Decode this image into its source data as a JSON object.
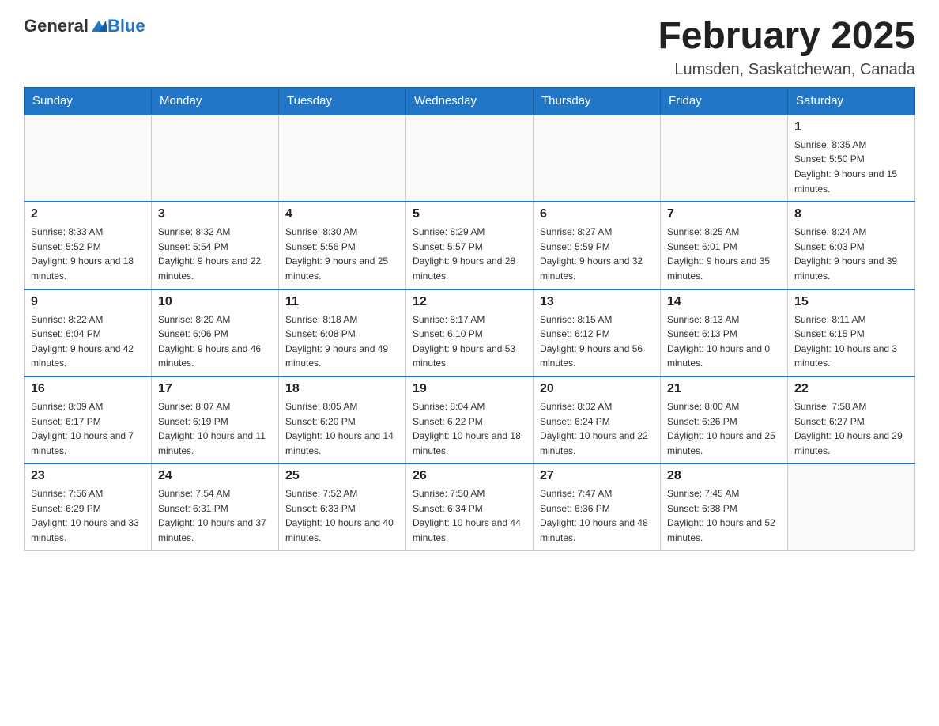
{
  "header": {
    "logo_general": "General",
    "logo_blue": "Blue",
    "month_title": "February 2025",
    "location": "Lumsden, Saskatchewan, Canada"
  },
  "weekdays": [
    "Sunday",
    "Monday",
    "Tuesday",
    "Wednesday",
    "Thursday",
    "Friday",
    "Saturday"
  ],
  "weeks": [
    [
      {
        "day": "",
        "sunrise": "",
        "sunset": "",
        "daylight": ""
      },
      {
        "day": "",
        "sunrise": "",
        "sunset": "",
        "daylight": ""
      },
      {
        "day": "",
        "sunrise": "",
        "sunset": "",
        "daylight": ""
      },
      {
        "day": "",
        "sunrise": "",
        "sunset": "",
        "daylight": ""
      },
      {
        "day": "",
        "sunrise": "",
        "sunset": "",
        "daylight": ""
      },
      {
        "day": "",
        "sunrise": "",
        "sunset": "",
        "daylight": ""
      },
      {
        "day": "1",
        "sunrise": "Sunrise: 8:35 AM",
        "sunset": "Sunset: 5:50 PM",
        "daylight": "Daylight: 9 hours and 15 minutes."
      }
    ],
    [
      {
        "day": "2",
        "sunrise": "Sunrise: 8:33 AM",
        "sunset": "Sunset: 5:52 PM",
        "daylight": "Daylight: 9 hours and 18 minutes."
      },
      {
        "day": "3",
        "sunrise": "Sunrise: 8:32 AM",
        "sunset": "Sunset: 5:54 PM",
        "daylight": "Daylight: 9 hours and 22 minutes."
      },
      {
        "day": "4",
        "sunrise": "Sunrise: 8:30 AM",
        "sunset": "Sunset: 5:56 PM",
        "daylight": "Daylight: 9 hours and 25 minutes."
      },
      {
        "day": "5",
        "sunrise": "Sunrise: 8:29 AM",
        "sunset": "Sunset: 5:57 PM",
        "daylight": "Daylight: 9 hours and 28 minutes."
      },
      {
        "day": "6",
        "sunrise": "Sunrise: 8:27 AM",
        "sunset": "Sunset: 5:59 PM",
        "daylight": "Daylight: 9 hours and 32 minutes."
      },
      {
        "day": "7",
        "sunrise": "Sunrise: 8:25 AM",
        "sunset": "Sunset: 6:01 PM",
        "daylight": "Daylight: 9 hours and 35 minutes."
      },
      {
        "day": "8",
        "sunrise": "Sunrise: 8:24 AM",
        "sunset": "Sunset: 6:03 PM",
        "daylight": "Daylight: 9 hours and 39 minutes."
      }
    ],
    [
      {
        "day": "9",
        "sunrise": "Sunrise: 8:22 AM",
        "sunset": "Sunset: 6:04 PM",
        "daylight": "Daylight: 9 hours and 42 minutes."
      },
      {
        "day": "10",
        "sunrise": "Sunrise: 8:20 AM",
        "sunset": "Sunset: 6:06 PM",
        "daylight": "Daylight: 9 hours and 46 minutes."
      },
      {
        "day": "11",
        "sunrise": "Sunrise: 8:18 AM",
        "sunset": "Sunset: 6:08 PM",
        "daylight": "Daylight: 9 hours and 49 minutes."
      },
      {
        "day": "12",
        "sunrise": "Sunrise: 8:17 AM",
        "sunset": "Sunset: 6:10 PM",
        "daylight": "Daylight: 9 hours and 53 minutes."
      },
      {
        "day": "13",
        "sunrise": "Sunrise: 8:15 AM",
        "sunset": "Sunset: 6:12 PM",
        "daylight": "Daylight: 9 hours and 56 minutes."
      },
      {
        "day": "14",
        "sunrise": "Sunrise: 8:13 AM",
        "sunset": "Sunset: 6:13 PM",
        "daylight": "Daylight: 10 hours and 0 minutes."
      },
      {
        "day": "15",
        "sunrise": "Sunrise: 8:11 AM",
        "sunset": "Sunset: 6:15 PM",
        "daylight": "Daylight: 10 hours and 3 minutes."
      }
    ],
    [
      {
        "day": "16",
        "sunrise": "Sunrise: 8:09 AM",
        "sunset": "Sunset: 6:17 PM",
        "daylight": "Daylight: 10 hours and 7 minutes."
      },
      {
        "day": "17",
        "sunrise": "Sunrise: 8:07 AM",
        "sunset": "Sunset: 6:19 PM",
        "daylight": "Daylight: 10 hours and 11 minutes."
      },
      {
        "day": "18",
        "sunrise": "Sunrise: 8:05 AM",
        "sunset": "Sunset: 6:20 PM",
        "daylight": "Daylight: 10 hours and 14 minutes."
      },
      {
        "day": "19",
        "sunrise": "Sunrise: 8:04 AM",
        "sunset": "Sunset: 6:22 PM",
        "daylight": "Daylight: 10 hours and 18 minutes."
      },
      {
        "day": "20",
        "sunrise": "Sunrise: 8:02 AM",
        "sunset": "Sunset: 6:24 PM",
        "daylight": "Daylight: 10 hours and 22 minutes."
      },
      {
        "day": "21",
        "sunrise": "Sunrise: 8:00 AM",
        "sunset": "Sunset: 6:26 PM",
        "daylight": "Daylight: 10 hours and 25 minutes."
      },
      {
        "day": "22",
        "sunrise": "Sunrise: 7:58 AM",
        "sunset": "Sunset: 6:27 PM",
        "daylight": "Daylight: 10 hours and 29 minutes."
      }
    ],
    [
      {
        "day": "23",
        "sunrise": "Sunrise: 7:56 AM",
        "sunset": "Sunset: 6:29 PM",
        "daylight": "Daylight: 10 hours and 33 minutes."
      },
      {
        "day": "24",
        "sunrise": "Sunrise: 7:54 AM",
        "sunset": "Sunset: 6:31 PM",
        "daylight": "Daylight: 10 hours and 37 minutes."
      },
      {
        "day": "25",
        "sunrise": "Sunrise: 7:52 AM",
        "sunset": "Sunset: 6:33 PM",
        "daylight": "Daylight: 10 hours and 40 minutes."
      },
      {
        "day": "26",
        "sunrise": "Sunrise: 7:50 AM",
        "sunset": "Sunset: 6:34 PM",
        "daylight": "Daylight: 10 hours and 44 minutes."
      },
      {
        "day": "27",
        "sunrise": "Sunrise: 7:47 AM",
        "sunset": "Sunset: 6:36 PM",
        "daylight": "Daylight: 10 hours and 48 minutes."
      },
      {
        "day": "28",
        "sunrise": "Sunrise: 7:45 AM",
        "sunset": "Sunset: 6:38 PM",
        "daylight": "Daylight: 10 hours and 52 minutes."
      },
      {
        "day": "",
        "sunrise": "",
        "sunset": "",
        "daylight": ""
      }
    ]
  ]
}
